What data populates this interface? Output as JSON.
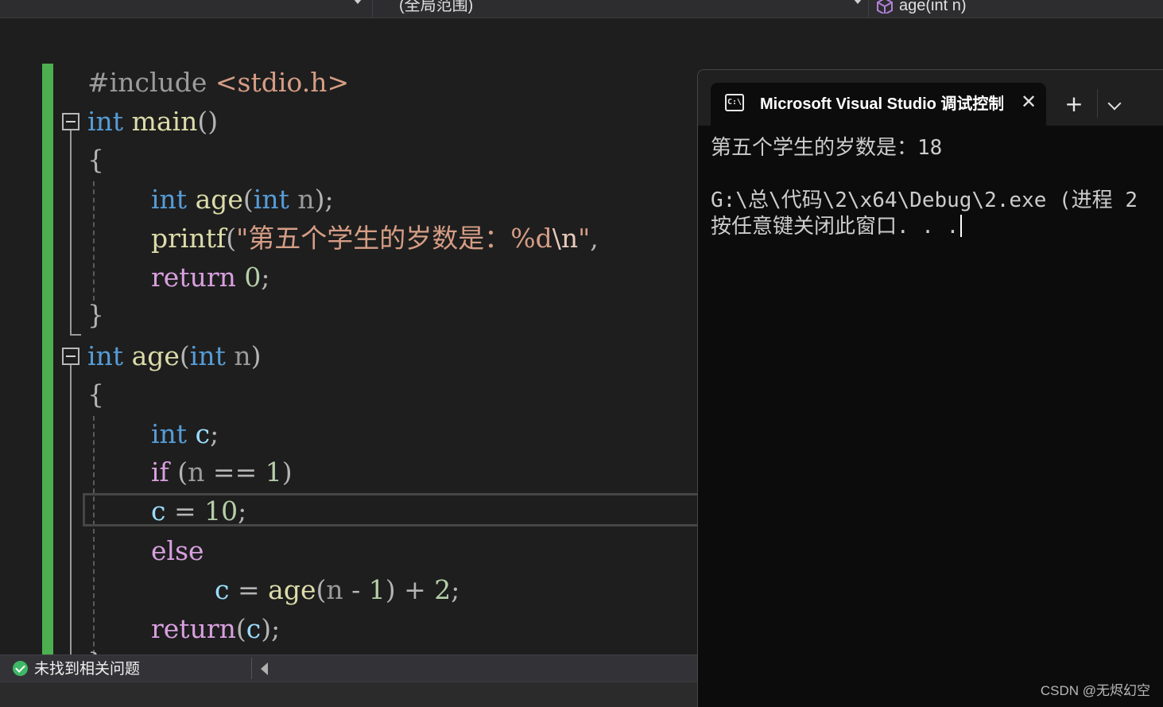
{
  "navbar": {
    "scope_label": "(全局范围)",
    "member_label": "age(int n)",
    "member_icon": "cube-icon"
  },
  "editor": {
    "lines": {
      "l1": {
        "pp": "#include ",
        "inc": "<stdio.h>"
      },
      "l2": {
        "type": "int",
        "name": "main",
        "paren": "()"
      },
      "l3": {
        "brace": "{"
      },
      "l4": {
        "type": "int",
        "name": "age",
        "open": "(",
        "ptype": "int",
        "param": "n",
        "close": ")",
        "semi": ";"
      },
      "l5": {
        "name": "printf",
        "open": "(",
        "str_a": "\"第五个学生的岁数是：%d",
        "esc": "\\n",
        "str_b": "\"",
        "comma": ","
      },
      "l6": {
        "kw": "return",
        "num": "0",
        "semi": ";"
      },
      "l7": {
        "brace": "}"
      },
      "l8": {
        "type": "int",
        "name": "age",
        "open": "(",
        "ptype": "int",
        "param": "n",
        "close": ")"
      },
      "l9": {
        "brace": "{"
      },
      "l10": {
        "type": "int",
        "var": "c",
        "semi": ";"
      },
      "l11": {
        "kw": "if",
        "open": "(",
        "var": "n",
        "op": "==",
        "num": "1",
        "close": ")"
      },
      "l12": {
        "var": "c",
        "op": "=",
        "num": "10",
        "semi": ";"
      },
      "l13": {
        "kw": "else"
      },
      "l14": {
        "var": "c",
        "op": "=",
        "name": "age",
        "open": "(",
        "param": "n",
        "minus": "-",
        "num1": "1",
        "close": ")",
        "plus": "+",
        "num2": "2",
        "semi": ";"
      },
      "l15": {
        "kw": "return",
        "open": "(",
        "var": "c",
        "close": ")",
        "semi": ";"
      },
      "l16": {
        "brace": "}"
      }
    }
  },
  "status": {
    "issues_text": "未找到相关问题",
    "icon": "check-circle-icon"
  },
  "terminal": {
    "tab_title": "Microsoft Visual Studio 调试控制台",
    "icon": "console-icon",
    "icon_glyph": "C:\\",
    "close_glyph": "✕",
    "new_tab_glyph": "+",
    "output": {
      "line1": "第五个学生的岁数是：18",
      "line2": "",
      "line3": "G:\\总\\代码\\2\\x64\\Debug\\2.exe (进程 2",
      "line4": "按任意键关闭此窗口. . ."
    }
  },
  "watermark": "CSDN @无烬幻空",
  "colors": {
    "keyword": "#569cd6",
    "control": "#d8a0df",
    "function": "#dcdcaa",
    "parameter": "#9a9a9a",
    "variable": "#9cdcfe",
    "number": "#b5cea8",
    "string": "#d69d85",
    "change_bar": "#4caf50"
  }
}
